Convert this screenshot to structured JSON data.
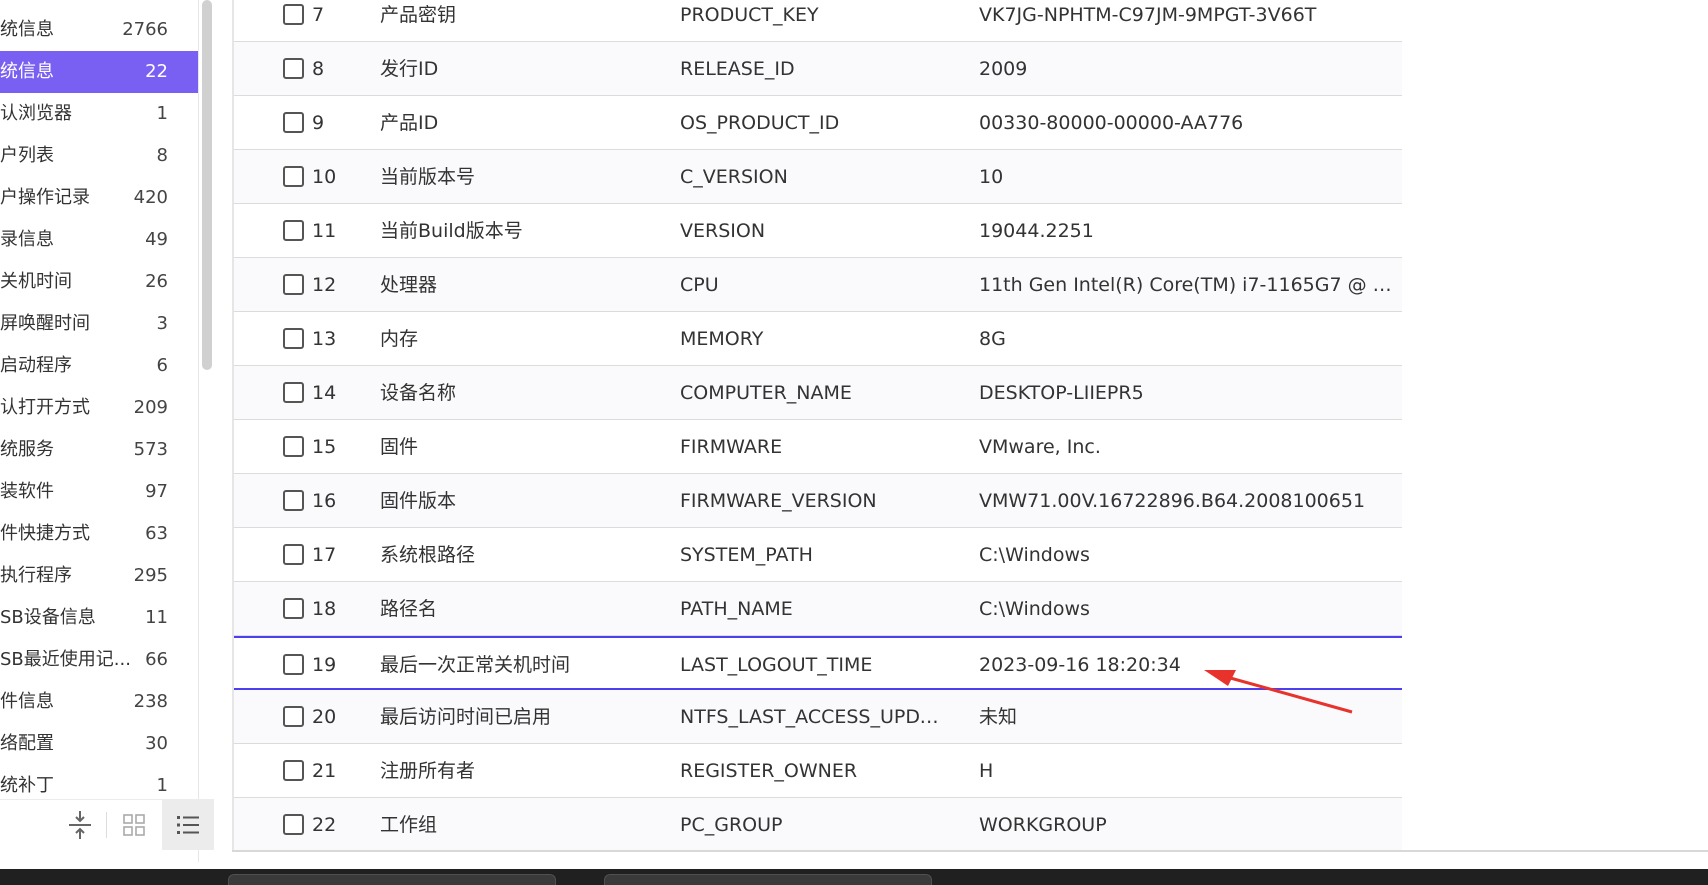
{
  "sidebar": {
    "items": [
      {
        "label": "统信息",
        "count": "2766"
      },
      {
        "label": "统信息",
        "count": "22"
      },
      {
        "label": "认浏览器",
        "count": "1"
      },
      {
        "label": "户列表",
        "count": "8"
      },
      {
        "label": "户操作记录",
        "count": "420"
      },
      {
        "label": "录信息",
        "count": "49"
      },
      {
        "label": "关机时间",
        "count": "26"
      },
      {
        "label": "屏唤醒时间",
        "count": "3"
      },
      {
        "label": "启动程序",
        "count": "6"
      },
      {
        "label": "认打开方式",
        "count": "209"
      },
      {
        "label": "统服务",
        "count": "573"
      },
      {
        "label": "装软件",
        "count": "97"
      },
      {
        "label": "件快捷方式",
        "count": "63"
      },
      {
        "label": "执行程序",
        "count": "295"
      },
      {
        "label": "SB设备信息",
        "count": "11"
      },
      {
        "label": "SB最近使用记...",
        "count": "66"
      },
      {
        "label": "件信息",
        "count": "238"
      },
      {
        "label": "络配置",
        "count": "30"
      },
      {
        "label": "统补丁",
        "count": "1"
      }
    ],
    "active_index": 1,
    "footer": {
      "collapse_icon": "collapse-vertical-icon",
      "grid_icon": "grid-view-icon",
      "list_icon": "list-view-icon"
    }
  },
  "table": {
    "rows": [
      {
        "num": "7",
        "name": "产品密钥",
        "key": "PRODUCT_KEY",
        "value": "VK7JG-NPHTM-C97JM-9MPGT-3V66T"
      },
      {
        "num": "8",
        "name": "发行ID",
        "key": "RELEASE_ID",
        "value": "2009"
      },
      {
        "num": "9",
        "name": "产品ID",
        "key": "OS_PRODUCT_ID",
        "value": "00330-80000-00000-AA776"
      },
      {
        "num": "10",
        "name": "当前版本号",
        "key": "C_VERSION",
        "value": "10"
      },
      {
        "num": "11",
        "name": "当前Build版本号",
        "key": "VERSION",
        "value": "19044.2251"
      },
      {
        "num": "12",
        "name": "处理器",
        "key": "CPU",
        "value": "11th Gen Intel(R) Core(TM) i7-1165G7 @ 2...."
      },
      {
        "num": "13",
        "name": "内存",
        "key": "MEMORY",
        "value": "8G"
      },
      {
        "num": "14",
        "name": "设备名称",
        "key": "COMPUTER_NAME",
        "value": "DESKTOP-LIIEPR5"
      },
      {
        "num": "15",
        "name": "固件",
        "key": "FIRMWARE",
        "value": "VMware, Inc."
      },
      {
        "num": "16",
        "name": "固件版本",
        "key": "FIRMWARE_VERSION",
        "value": "VMW71.00V.16722896.B64.2008100651"
      },
      {
        "num": "17",
        "name": "系统根路径",
        "key": "SYSTEM_PATH",
        "value": "C:\\Windows"
      },
      {
        "num": "18",
        "name": "路径名",
        "key": "PATH_NAME",
        "value": "C:\\Windows"
      },
      {
        "num": "19",
        "name": "最后一次正常关机时间",
        "key": "LAST_LOGOUT_TIME",
        "value": "2023-09-16 18:20:34"
      },
      {
        "num": "20",
        "name": "最后访问时间已启用",
        "key": "NTFS_LAST_ACCESS_UPDA...",
        "value": "未知"
      },
      {
        "num": "21",
        "name": "注册所有者",
        "key": "REGISTER_OWNER",
        "value": "H"
      },
      {
        "num": "22",
        "name": "工作组",
        "key": "PC_GROUP",
        "value": "WORKGROUP"
      }
    ],
    "selected_row_num": "19"
  },
  "annotation": {
    "color": "#e8322c",
    "icon": "red-arrow-annotation"
  },
  "colors": {
    "accent": "#7a60f2",
    "selected_border": "#4b3ff0"
  }
}
